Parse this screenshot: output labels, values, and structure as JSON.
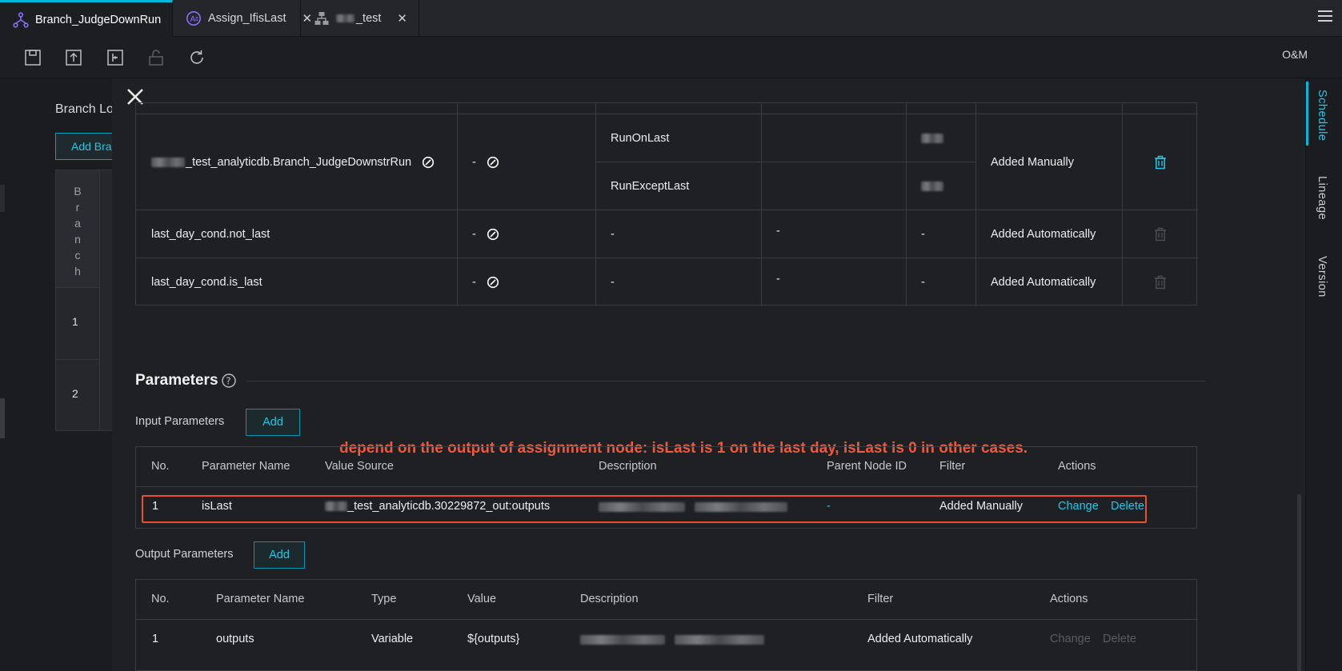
{
  "tabs": [
    {
      "label": "Branch_JudgeDownRun",
      "icon": "branch-node-icon",
      "active": true,
      "modified": true
    },
    {
      "label": "Assign_IfisLast",
      "icon": "assignment-node-icon",
      "active": false
    },
    {
      "label": "_test",
      "icon": "workflow-icon",
      "active": false
    }
  ],
  "toolbar": {
    "icons": [
      "save-icon",
      "submit-icon",
      "deploy-icon",
      "lock-icon",
      "refresh-icon"
    ],
    "om_label": "O&M"
  },
  "background": {
    "title": "Branch Lo",
    "add_button": "Add Bra",
    "branch_header": "Branch",
    "rows": [
      "1",
      "2"
    ]
  },
  "right_tabs": [
    {
      "label": "Schedule",
      "active": true
    },
    {
      "label": "Lineage",
      "active": false
    },
    {
      "label": "Version",
      "active": false
    }
  ],
  "dependencies": {
    "rows": [
      {
        "output_name": "_test_analyticdb.Branch_JudgeDownstrRun",
        "output_table": "-",
        "sub_rows": [
          {
            "name": "RunOnLast",
            "col4": "",
            "col5": ""
          },
          {
            "name": "RunExceptLast",
            "col4": "",
            "col5": ""
          }
        ],
        "source": "Added Manually",
        "deletable": true
      },
      {
        "output_name": "last_day_cond.not_last",
        "output_table": "-",
        "name": "-",
        "col4": "-",
        "col5": "-",
        "source": "Added Automatically",
        "deletable": false
      },
      {
        "output_name": "last_day_cond.is_last",
        "output_table": "-",
        "name": "-",
        "col4": "-",
        "col5": "-",
        "source": "Added Automatically",
        "deletable": false
      }
    ]
  },
  "parameters": {
    "title": "Parameters",
    "input_label": "Input Parameters",
    "output_label": "Output Parameters",
    "add_label": "Add",
    "input_headers": [
      "No.",
      "Parameter Name",
      "Value Source",
      "Description",
      "Parent Node ID",
      "Filter",
      "Actions"
    ],
    "input_rows": [
      {
        "no": "1",
        "name": "isLast",
        "value_source": "_test_analyticdb.30229872_out:outputs",
        "description": "",
        "parent_node_id": "-",
        "filter": "Added Manually",
        "actions": [
          "Change",
          "Delete"
        ]
      }
    ],
    "output_headers": [
      "No.",
      "Parameter Name",
      "Type",
      "Value",
      "Description",
      "Filter",
      "Actions"
    ],
    "output_rows": [
      {
        "no": "1",
        "name": "outputs",
        "type": "Variable",
        "value": "${outputs}",
        "description": "",
        "filter": "Added Automatically",
        "actions": [
          "Change",
          "Delete"
        ]
      }
    ]
  },
  "annotation": "depend on the output of assignment node: isLast is 1 on the last day, isLast is 0 in other cases.",
  "colors": {
    "accent": "#22c7e6",
    "annotation": "#f05a3c",
    "background": "#1f2023"
  }
}
